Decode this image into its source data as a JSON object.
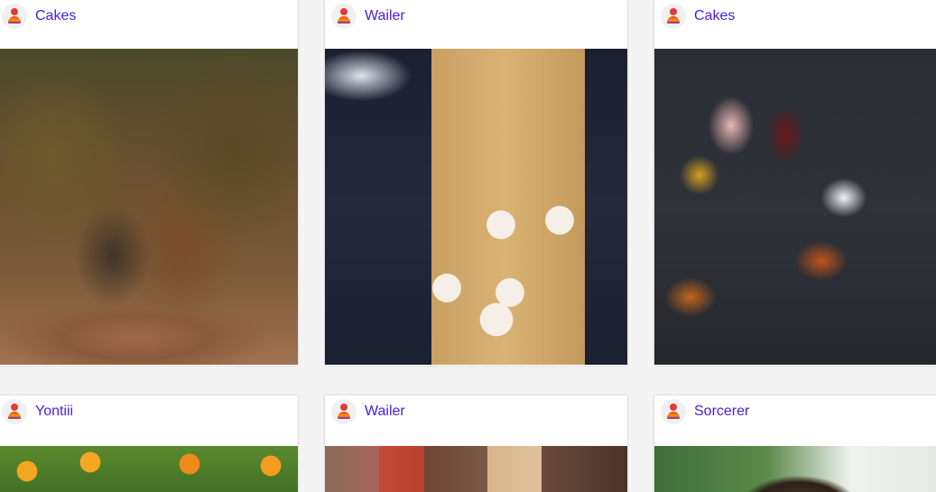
{
  "cards": [
    {
      "author": "Cakes",
      "photo": "Mountain biker on forest trail"
    },
    {
      "author": "Wailer",
      "photo": "Cupcakes with strawberries on wooden board"
    },
    {
      "author": "Cakes",
      "photo": "Spices and peppercorns in spoons"
    },
    {
      "author": "Yontiii",
      "photo": "Oranges with green leaves"
    },
    {
      "author": "Wailer",
      "photo": "Colorful street buildings"
    },
    {
      "author": "Sorcerer",
      "photo": "Portrait with dreadlocks"
    }
  ],
  "colors": {
    "author_link": "#4a1fe0",
    "page_background": "#f4f4f4"
  }
}
